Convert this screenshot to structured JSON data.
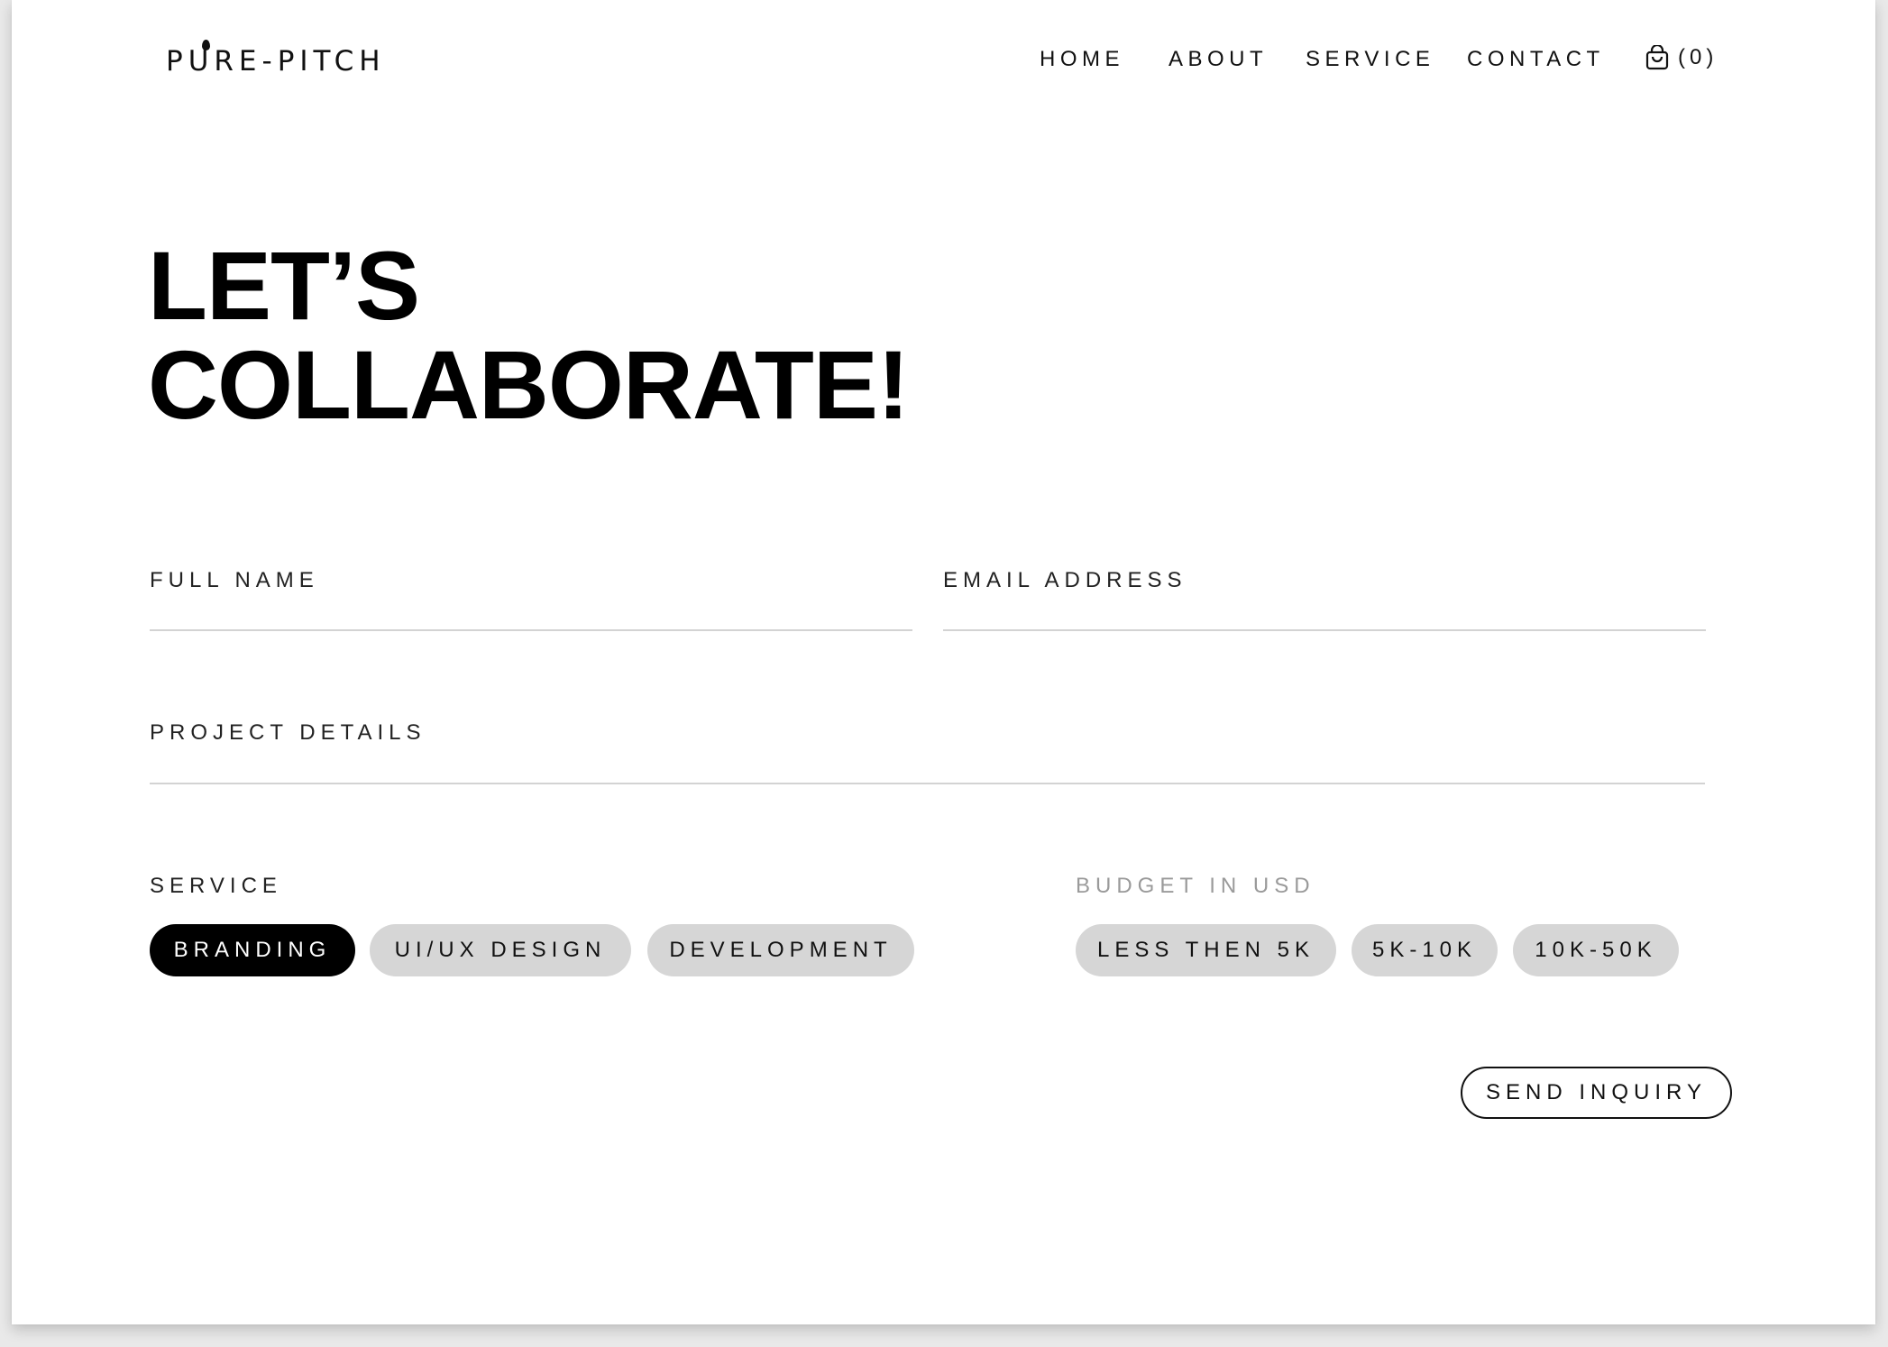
{
  "brand": {
    "logo_text": "PURE-PITCH"
  },
  "nav": {
    "items": [
      {
        "label": "HOME"
      },
      {
        "label": "ABOUT"
      },
      {
        "label": "SERVICE"
      },
      {
        "label": "CONTACT"
      }
    ],
    "cart_count": "(0)"
  },
  "hero": {
    "line1": "LET’S",
    "line2": "COLLABORATE!"
  },
  "form": {
    "full_name_label": "FULL NAME",
    "full_name_value": "",
    "email_label": "EMAIL ADDRESS",
    "email_value": "",
    "project_label": "PROJECT DETAILS",
    "project_value": "",
    "service_label": "SERVICE",
    "service_options": [
      {
        "label": "BRANDING",
        "selected": true
      },
      {
        "label": "UI/UX DESIGN",
        "selected": false
      },
      {
        "label": "DEVELOPMENT",
        "selected": false
      }
    ],
    "budget_label": "BUDGET IN USD",
    "budget_options": [
      {
        "label": "LESS THEN 5K",
        "selected": false
      },
      {
        "label": "5K-10K",
        "selected": false
      },
      {
        "label": "10K-50K",
        "selected": false
      }
    ],
    "submit_label": "SEND INQUIRY"
  },
  "colors": {
    "background": "#ffffff",
    "text": "#111111",
    "pill_default": "#d6d6d6",
    "pill_selected": "#000000",
    "muted_label": "#9a9a9a",
    "field_line": "#d3d3d3"
  },
  "icons": {
    "cart": "shopping-bag-icon"
  }
}
